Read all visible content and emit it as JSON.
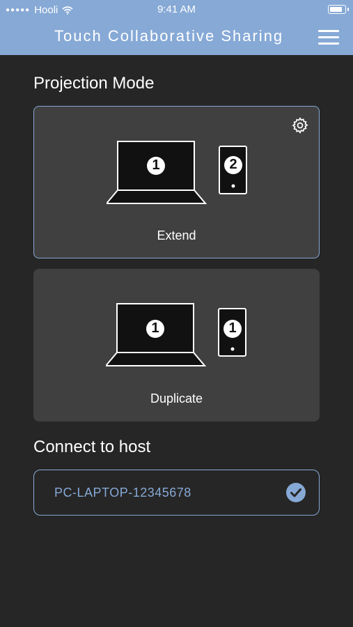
{
  "status_bar": {
    "carrier": "Hooli",
    "time": "9:41 AM",
    "signal_icon": "signal-dots-icon",
    "wifi_icon": "wifi-icon",
    "battery_icon": "battery-icon"
  },
  "header": {
    "title": "Touch Collaborative Sharing",
    "menu_icon": "hamburger-menu-icon",
    "background_color": "#86a9d6"
  },
  "projection": {
    "section_title": "Projection Mode",
    "modes": [
      {
        "label": "Extend",
        "laptop_number": "1",
        "phone_number": "2",
        "selected": true
      },
      {
        "label": "Duplicate",
        "laptop_number": "1",
        "phone_number": "1",
        "selected": false
      }
    ],
    "settings_icon": "gear-icon"
  },
  "connect": {
    "section_title": "Connect to host",
    "host_name": "PC-LAPTOP-12345678",
    "connected": true,
    "check_icon": "check-circle-icon"
  },
  "colors": {
    "accent": "#86a9d6",
    "background": "#262626",
    "card": "#404040"
  }
}
